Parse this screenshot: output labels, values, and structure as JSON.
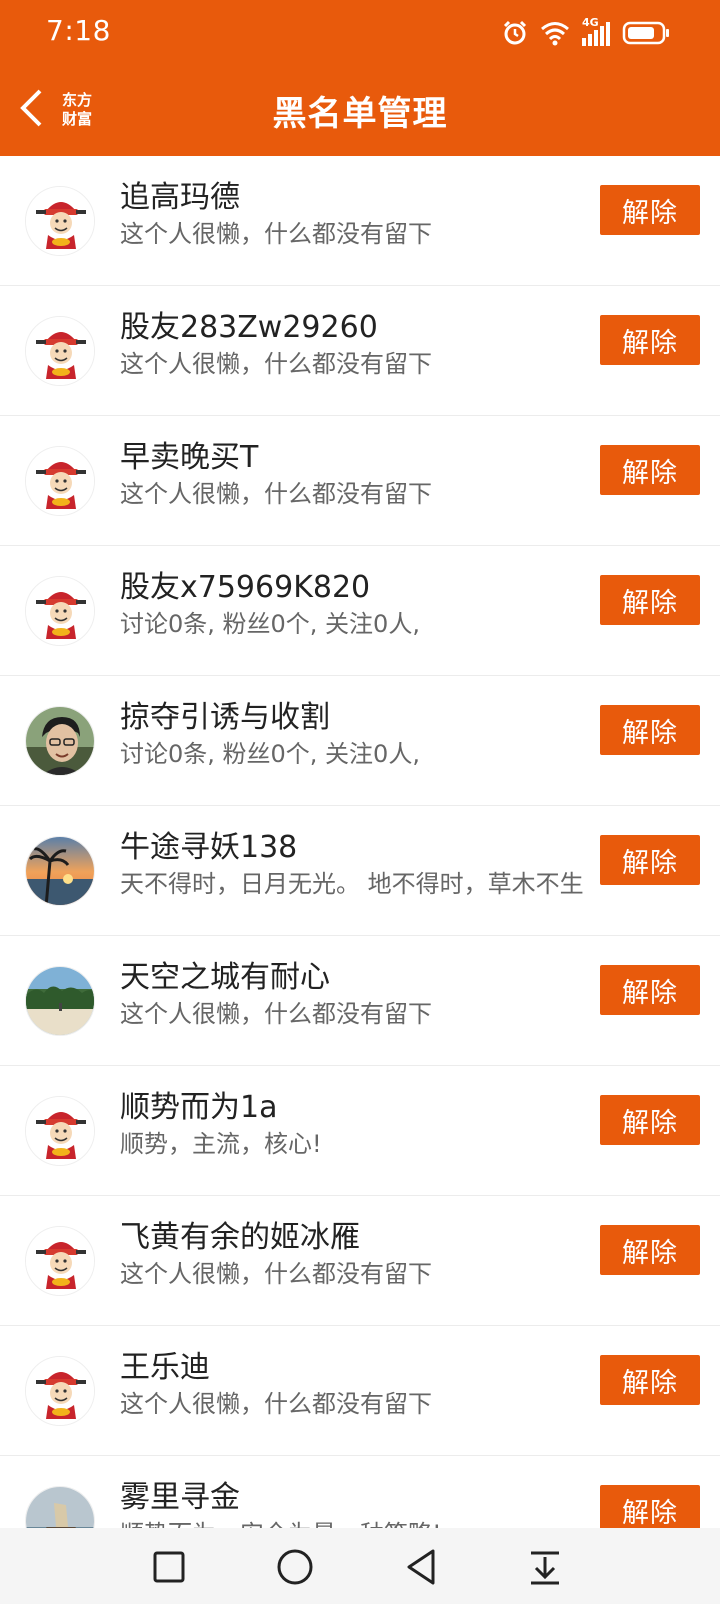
{
  "status": {
    "time": "7:18",
    "network": "4G"
  },
  "header": {
    "title": "黑名单管理",
    "brand_line1": "东方",
    "brand_line2": "财富"
  },
  "unblock_label": "解除",
  "colors": {
    "accent": "#e85a0c",
    "nav_bg": "#f5f5f5"
  },
  "users": [
    {
      "name": "追高玛德",
      "desc": "这个人很懒，什么都没有留下",
      "avatar": "caishen"
    },
    {
      "name": "股友283Zw29260",
      "desc": "这个人很懒，什么都没有留下",
      "avatar": "caishen"
    },
    {
      "name": "早卖晚买T",
      "desc": "这个人很懒，什么都没有留下",
      "avatar": "caishen"
    },
    {
      "name": "股友x75969K820",
      "desc": "讨论0条, 粉丝0个, 关注0人,",
      "avatar": "caishen"
    },
    {
      "name": "掠夺引诱与收割",
      "desc": "讨论0条, 粉丝0个, 关注0人,",
      "avatar": "person-photo"
    },
    {
      "name": "牛途寻妖138",
      "desc": "天不得时，日月无光。 地不得时，草木不生",
      "avatar": "sunset-photo"
    },
    {
      "name": "天空之城有耐心",
      "desc": "这个人很懒，什么都没有留下",
      "avatar": "beach-photo"
    },
    {
      "name": "顺势而为1a",
      "desc": "顺势，主流，核心!",
      "avatar": "caishen"
    },
    {
      "name": "飞黄有余的姬冰雁",
      "desc": "这个人很懒，什么都没有留下",
      "avatar": "caishen"
    },
    {
      "name": "王乐迪",
      "desc": "这个人很懒，什么都没有留下",
      "avatar": "caishen"
    },
    {
      "name": "雾里寻金",
      "desc": "顺势而为，安全为最，种策略!",
      "avatar": "ship-photo"
    }
  ],
  "nav": {
    "icons": [
      "recent-apps-icon",
      "home-icon",
      "back-icon",
      "notification-pull-icon"
    ]
  }
}
